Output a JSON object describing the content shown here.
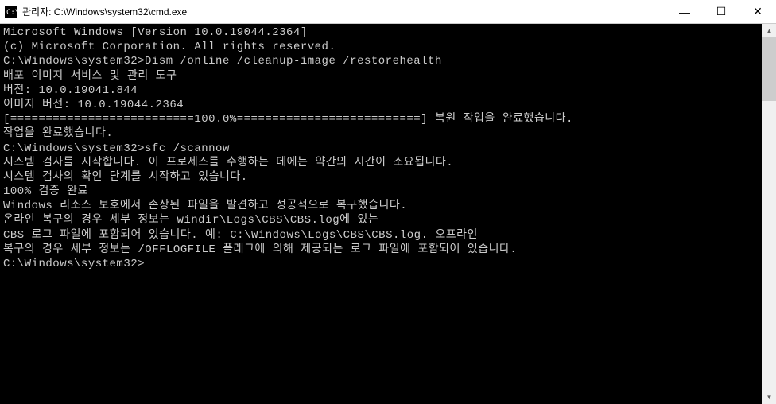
{
  "titlebar": {
    "text": "관리자: C:\\Windows\\system32\\cmd.exe"
  },
  "terminal": {
    "lines": [
      "Microsoft Windows [Version 10.0.19044.2364]",
      "(c) Microsoft Corporation. All rights reserved.",
      "",
      "C:\\Windows\\system32>Dism /online /cleanup-image /restorehealth",
      "",
      "배포 이미지 서비스 및 관리 도구",
      "버전: 10.0.19041.844",
      "",
      "이미지 버전: 10.0.19044.2364",
      "",
      "[==========================100.0%==========================] 복원 작업을 완료했습니다.",
      "작업을 완료했습니다.",
      "",
      "C:\\Windows\\system32>sfc /scannow",
      "",
      "시스템 검사를 시작합니다. 이 프로세스를 수행하는 데에는 약간의 시간이 소요됩니다.",
      "",
      "시스템 검사의 확인 단계를 시작하고 있습니다.",
      "100% 검증 완료",
      "",
      "Windows 리소스 보호에서 손상된 파일을 발견하고 성공적으로 복구했습니다.",
      "온라인 복구의 경우 세부 정보는 windir\\Logs\\CBS\\CBS.log에 있는",
      "CBS 로그 파일에 포함되어 있습니다. 예: C:\\Windows\\Logs\\CBS\\CBS.log. 오프라인",
      "복구의 경우 세부 정보는 /OFFLOGFILE 플래그에 의해 제공되는 로그 파일에 포함되어 있습니다.",
      "",
      "C:\\Windows\\system32>"
    ]
  },
  "buttons": {
    "minimize": "—",
    "maximize": "☐",
    "close": "✕"
  },
  "scrollbar": {
    "up": "▲",
    "down": "▼"
  }
}
